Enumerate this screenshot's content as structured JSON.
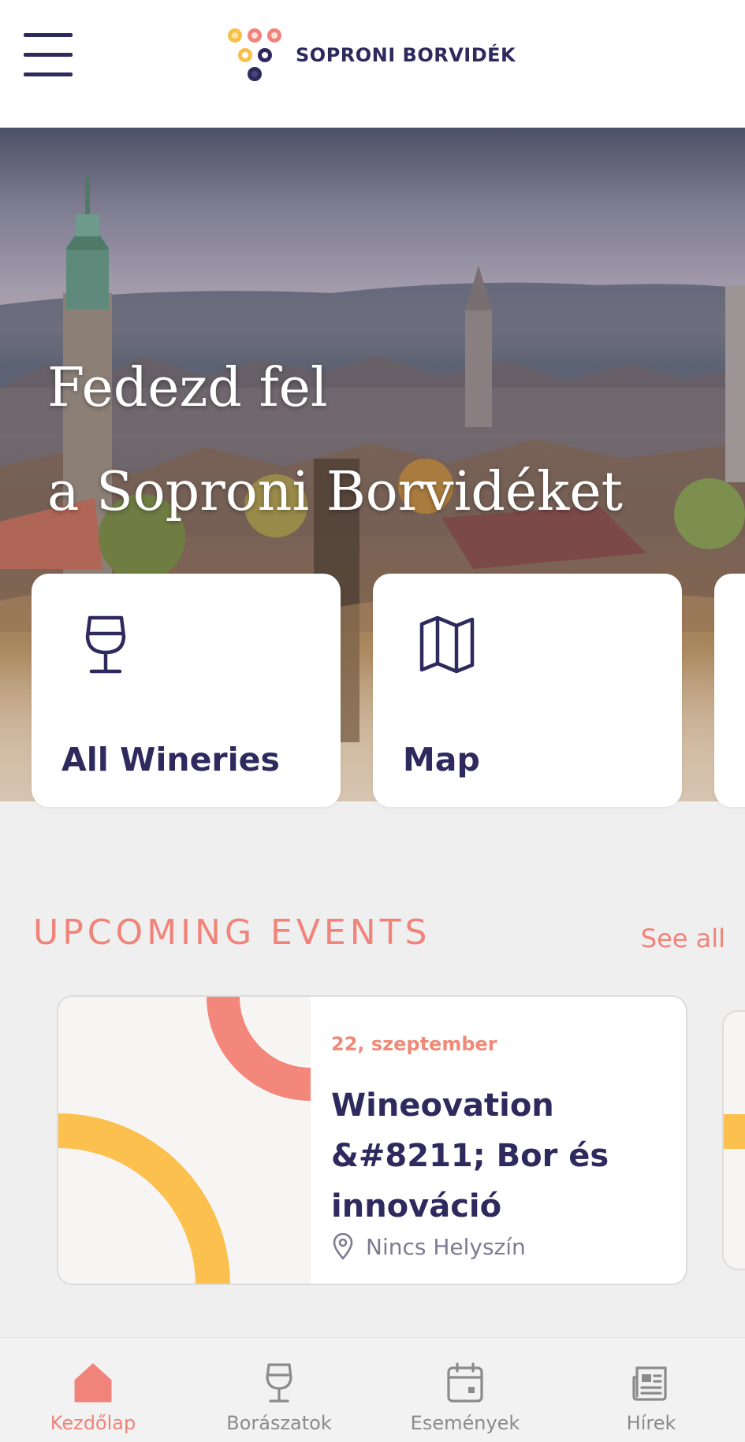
{
  "header": {
    "menu_icon": "hamburger-menu-icon",
    "logo_text": "SOPRONI BORVIDÉK",
    "logo_colors": [
      "#f7c04a",
      "#f0847a",
      "#2e2a5e"
    ]
  },
  "hero": {
    "title_line1": "Fedezd fel",
    "title_line2": "a Soproni Borvidéket"
  },
  "quick_links": [
    {
      "label": "All Wineries",
      "icon": "wine-glass-icon"
    },
    {
      "label": "Map",
      "icon": "map-icon"
    }
  ],
  "events": {
    "section_title": "UPCOMING EVENTS",
    "see_all": "See all",
    "items": [
      {
        "date": "22, szeptember",
        "title": "Wineovation &#8211; Bor és innováció",
        "location": "Nincs Helyszín"
      }
    ]
  },
  "bottom_nav": {
    "items": [
      {
        "label": "Kezdőlap",
        "icon": "home-icon",
        "active": true
      },
      {
        "label": "Borászatok",
        "icon": "wine-glass-icon",
        "active": false
      },
      {
        "label": "Események",
        "icon": "calendar-icon",
        "active": false
      },
      {
        "label": "Hírek",
        "icon": "newspaper-icon",
        "active": false
      }
    ]
  },
  "colors": {
    "brand_navy": "#2e2a5e",
    "accent_coral": "#f0847a",
    "accent_yellow": "#f7c04a",
    "background": "#efefef"
  }
}
